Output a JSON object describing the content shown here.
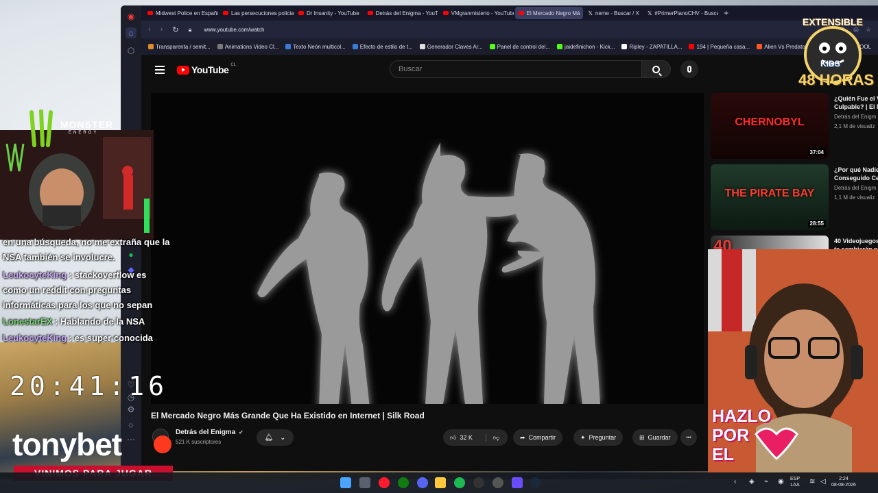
{
  "browser": {
    "tabs": [
      {
        "label": "Midwest Police en Españo",
        "fav": "youtube-icon"
      },
      {
        "label": "Las persecuciones policial",
        "fav": "youtube-icon"
      },
      {
        "label": "Dr Insanity - YouTube",
        "fav": "youtube-icon"
      },
      {
        "label": "Detrás del Enigma - YouTu",
        "fav": "youtube-icon"
      },
      {
        "label": "VMgranmisterio - YouTube",
        "fav": "youtube-icon"
      },
      {
        "label": "El Mercado Negro Má",
        "fav": "youtube-icon",
        "active": true
      },
      {
        "label": "neme - Buscar / X",
        "fav": "x-icon"
      },
      {
        "label": "#PrimerPlanoCHV - Busca",
        "fav": "x-icon"
      }
    ],
    "new_tab": "+",
    "url": "www.youtube.com/watch",
    "bookmarks": [
      {
        "label": "Transparenta / semit...",
        "color": "#e08a2a"
      },
      {
        "label": "Animations Video Cl...",
        "color": "#7a7a7a"
      },
      {
        "label": "Texto Neón multicol...",
        "color": "#3a7bd5"
      },
      {
        "label": "Efecto de estilo de t...",
        "color": "#3a7bd5"
      },
      {
        "label": "Generador Claves Ar...",
        "color": "#dddddd"
      },
      {
        "label": "Panel de control del...",
        "color": "#53fc18"
      },
      {
        "label": "jaidefinichon - Kick...",
        "color": "#53fc18"
      },
      {
        "label": "Ripley - ZAPATILLA...",
        "color": "#ffffff"
      },
      {
        "label": "194 | Pequeña casa...",
        "color": "#ff0000"
      },
      {
        "label": "Alien Vs Predator-alf...",
        "color": "#ff5722"
      },
      {
        "label": "cre",
        "color": "#ff0000"
      },
      {
        "label": "COOL",
        "color": "#ffffff"
      }
    ]
  },
  "youtube": {
    "logo": "YouTube",
    "logo_region": "CL",
    "search_placeholder": "Buscar",
    "video_title": "El Mercado Negro Más Grande Que Ha Existido en Internet | Silk Road",
    "channel_name": "Detrás del Enigma",
    "verified": "✔",
    "subscribers": "521 K suscriptores",
    "likes": "32 K",
    "share": "Compartir",
    "ask": "Preguntar",
    "save": "Guardar",
    "more": "•••",
    "recommendations": [
      {
        "title": "¿Quién Fue el V Culpable? | El M",
        "channel": "Detrás del Enigm",
        "views": "2,1 M de visualiz",
        "duration": "37:04",
        "thumb_text": "CHERNOBYL",
        "thumb_color": "#ff2a2a"
      },
      {
        "title": "¿Por qué Nadie Conseguido Ce",
        "channel": "Detrás del Enigm",
        "views": "1,1 M de visualiz",
        "duration": "28:55",
        "thumb_text": "THE PIRATE BAY",
        "thumb_color": "#ff3b2f"
      },
      {
        "title": "40 Videojuegos te cambiarán p",
        "channel": "",
        "views": "",
        "duration": "",
        "thumb_text": "40",
        "thumb_color": "#e53935"
      }
    ]
  },
  "overlay": {
    "monster_brand": "MONSTER",
    "monster_sub": "ENERGY",
    "chat": [
      {
        "user": "",
        "text": "en una búsqueda, no me extraña que la",
        "user_class": ""
      },
      {
        "user": "",
        "text": "NSA también se involucre.",
        "user_class": ""
      },
      {
        "user": "LeukocyteKing",
        "text": " : stackoverflow es",
        "user_class": ""
      },
      {
        "user": "",
        "text": "como un reddit con preguntas",
        "user_class": ""
      },
      {
        "user": "",
        "text": "informáticas para los que no sepan",
        "user_class": ""
      },
      {
        "user": "LonestarEX",
        "text": " : Hablando de la NSA",
        "user_class": "green"
      },
      {
        "user": "LeukocyteKing",
        "text": " : es super conocida",
        "user_class": ""
      }
    ],
    "clock": "20:41:16",
    "tonybet": "tonybet",
    "vinimos": "VINIMOS PARA JUGAR",
    "extensible": "EXTENSIBLE",
    "kids": "KIDS",
    "horas": "48 HORAS",
    "hazlo": [
      "HAZLO",
      "POR",
      "EL"
    ]
  },
  "taskbar": {
    "lang": "ESP",
    "lang_sub": "LAA",
    "time": "2:24",
    "date": "08-08-2026"
  }
}
